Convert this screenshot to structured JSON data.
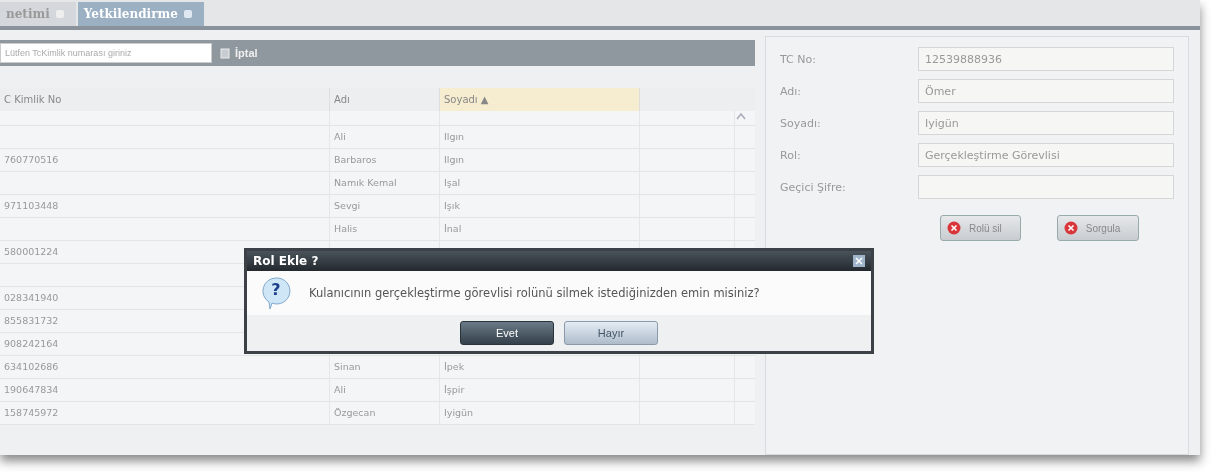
{
  "tabs": [
    {
      "label": "netimi",
      "selected": false
    },
    {
      "label": "Yetkilendirme",
      "selected": true
    }
  ],
  "search": {
    "placeholder": "Lütfen TcKimlik numarası giriniz",
    "button": "İptal"
  },
  "table": {
    "columns": [
      {
        "label": "C Kimlik No",
        "sorted": false
      },
      {
        "label": "Adı",
        "sorted": false
      },
      {
        "label": "Soyadı ▲",
        "sorted": true
      }
    ],
    "rows": [
      {
        "cells": [
          "",
          "Ali",
          "Ilgın"
        ]
      },
      {
        "cells": [
          "760770516",
          "Barbaros",
          "Ilgın"
        ]
      },
      {
        "cells": [
          "",
          "Namık Kemal",
          "Işal"
        ]
      },
      {
        "cells": [
          "971103448",
          "Sevgi",
          "Işık"
        ]
      },
      {
        "cells": [
          "",
          "Halis",
          "İnal"
        ]
      },
      {
        "cells": [
          "580001224",
          "",
          ""
        ]
      },
      {
        "cells": [
          "",
          "",
          ""
        ]
      },
      {
        "cells": [
          "028341940",
          "",
          ""
        ]
      },
      {
        "cells": [
          "855831732",
          "",
          ""
        ]
      },
      {
        "cells": [
          "908242164",
          "",
          ""
        ]
      },
      {
        "cells": [
          "634102686",
          "Sinan",
          "İpek"
        ]
      },
      {
        "cells": [
          "190647834",
          "Ali",
          "İşpir"
        ]
      },
      {
        "cells": [
          "158745972",
          "Özgecan",
          "Iyigün"
        ]
      }
    ]
  },
  "form": {
    "fields": [
      {
        "label": "TC No:",
        "value": "12539888936"
      },
      {
        "label": "Adı:",
        "value": "Ömer"
      },
      {
        "label": "Soyadı:",
        "value": "Iyigün"
      },
      {
        "label": "Rol:",
        "value": "Gerçekleştirme Görevlisi"
      },
      {
        "label": "Geçici Şifre:"
      }
    ],
    "buttons": [
      "Rolü sil",
      "Sorgula"
    ]
  },
  "dialog": {
    "title": "Rol Ekle ?",
    "icon": "?",
    "message": "Kulanıcının gerçekleştirme görevlisi rolünü silmek istediğinizden emin misiniz?",
    "buttons": [
      {
        "label": "Evet",
        "selected": true
      },
      {
        "label": "Hayır",
        "selected": false
      }
    ]
  }
}
